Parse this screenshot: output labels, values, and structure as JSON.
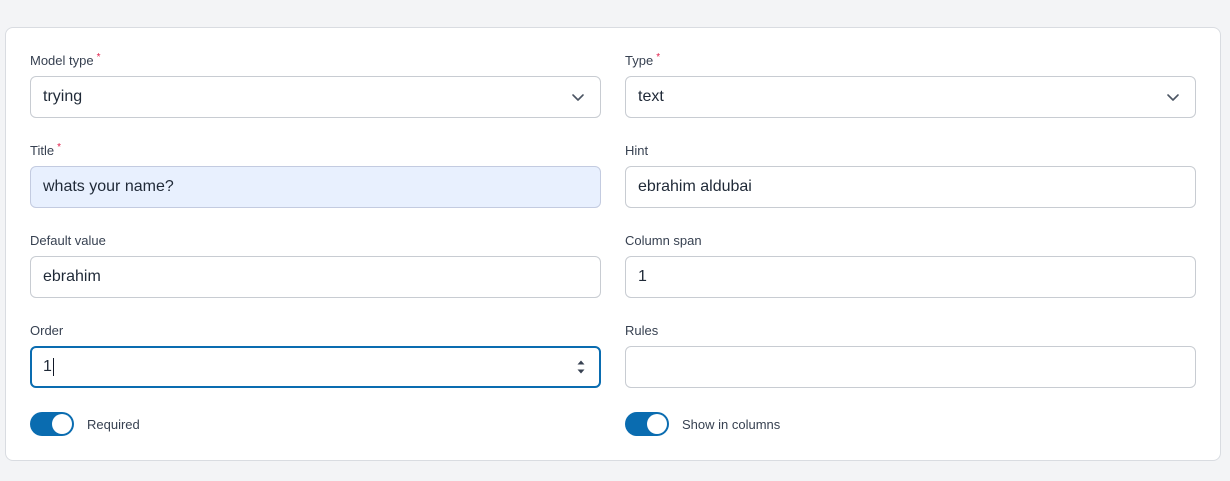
{
  "form": {
    "model_type": {
      "label": "Model type",
      "required_mark": "*",
      "value": "trying",
      "icon": "chevron-down-icon"
    },
    "type": {
      "label": "Type",
      "required_mark": "*",
      "value": "text",
      "icon": "chevron-down-icon"
    },
    "title": {
      "label": "Title",
      "required_mark": "*",
      "value": "whats your name?"
    },
    "hint": {
      "label": "Hint",
      "value": "ebrahim aldubai"
    },
    "default_value": {
      "label": "Default value",
      "value": "ebrahim"
    },
    "column_span": {
      "label": "Column span",
      "value": "1"
    },
    "order": {
      "label": "Order",
      "value": "1",
      "icon": "spinner-arrows-icon"
    },
    "rules": {
      "label": "Rules",
      "value": ""
    },
    "required_toggle": {
      "label": "Required",
      "on": true
    },
    "show_in_columns_toggle": {
      "label": "Show in columns",
      "on": true
    }
  },
  "colors": {
    "accent": "#0a6cb0",
    "required_mark": "#e11d48",
    "autofill_bg": "#e8f0fe"
  }
}
